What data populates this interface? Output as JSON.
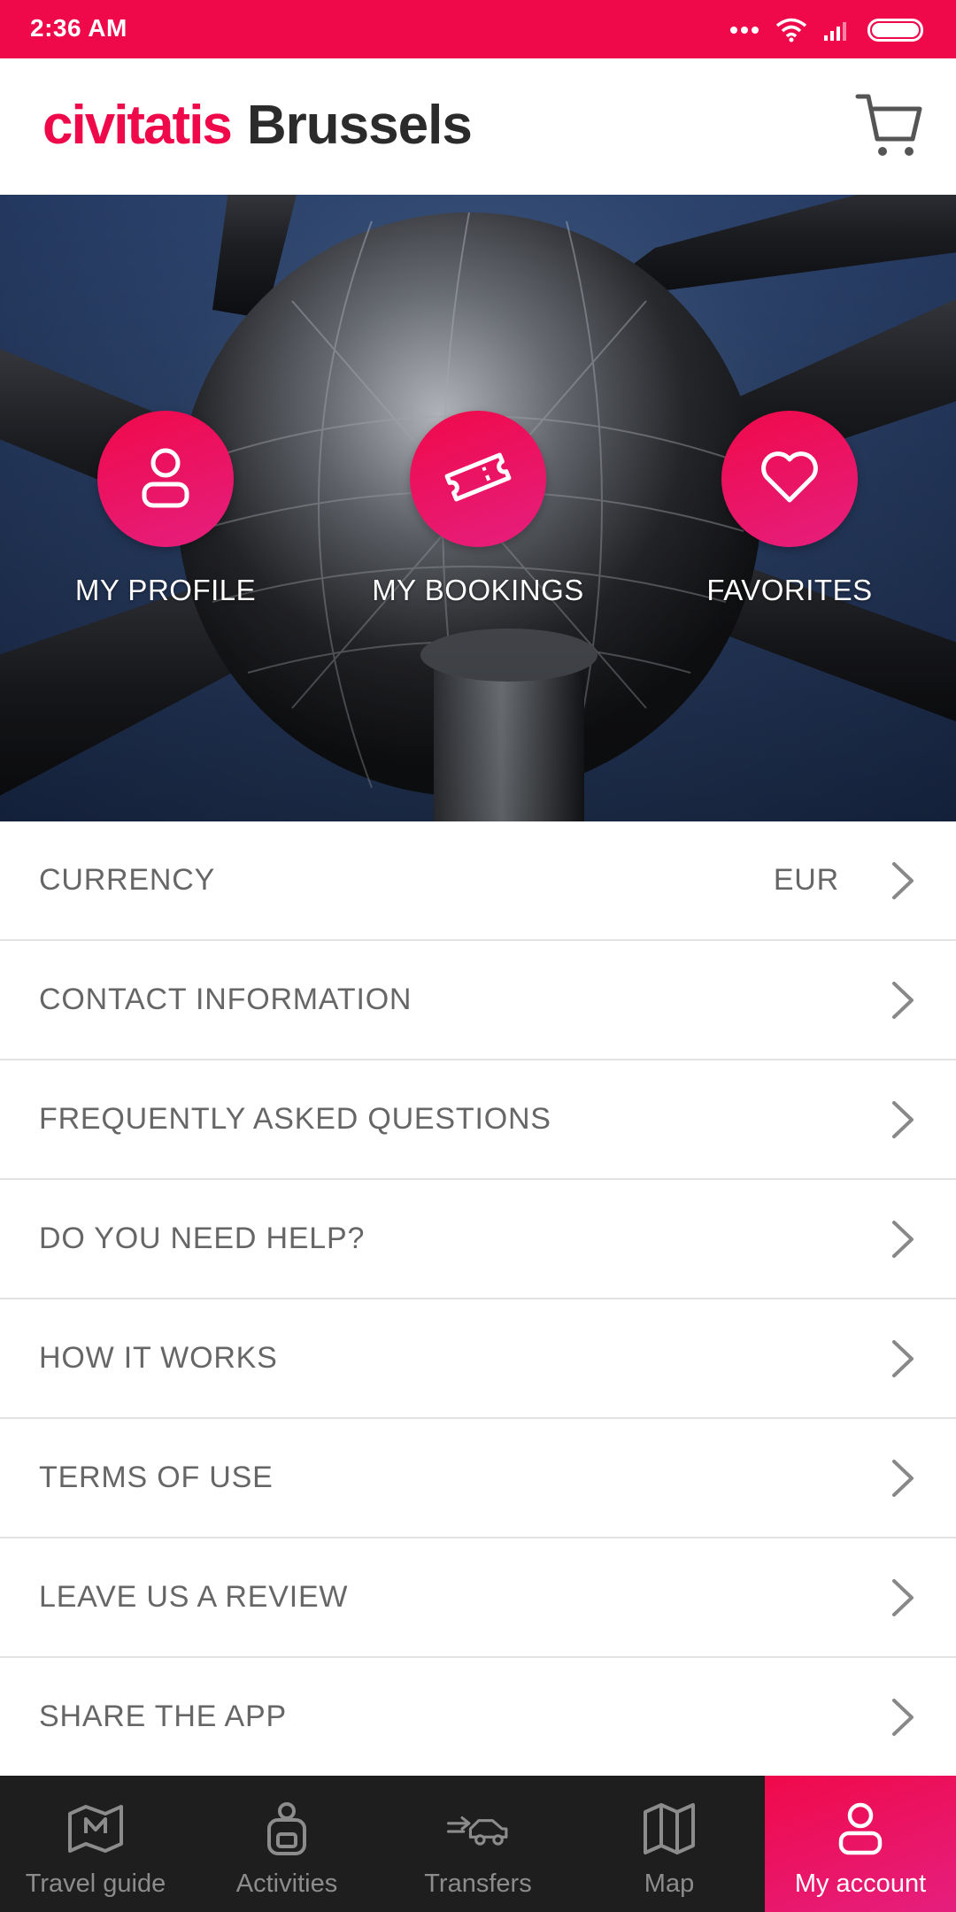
{
  "status_bar": {
    "time": "2:36 AM",
    "background": "#f0094a",
    "icons": [
      "more-dots-icon",
      "wifi-icon",
      "signal-icon",
      "battery-icon"
    ]
  },
  "header": {
    "logo_text": "civitatis",
    "city": "Brussels",
    "cart_icon": "cart-icon"
  },
  "hero": {
    "actions": [
      {
        "label": "MY PROFILE",
        "icon": "user-icon"
      },
      {
        "label": "MY BOOKINGS",
        "icon": "ticket-icon"
      },
      {
        "label": "FAVORITES",
        "icon": "heart-icon"
      }
    ]
  },
  "menu": {
    "items": [
      {
        "label": "CURRENCY",
        "value": "EUR"
      },
      {
        "label": "CONTACT INFORMATION",
        "value": ""
      },
      {
        "label": "FREQUENTLY ASKED QUESTIONS",
        "value": ""
      },
      {
        "label": "DO YOU NEED HELP?",
        "value": ""
      },
      {
        "label": "HOW IT WORKS",
        "value": ""
      },
      {
        "label": "TERMS OF USE",
        "value": ""
      },
      {
        "label": "LEAVE US A REVIEW",
        "value": ""
      },
      {
        "label": "SHARE THE APP",
        "value": ""
      }
    ]
  },
  "bottom_nav": {
    "items": [
      {
        "label": "Travel guide",
        "icon": "map-pin-icon",
        "active": false
      },
      {
        "label": "Activities",
        "icon": "backpack-icon",
        "active": false
      },
      {
        "label": "Transfers",
        "icon": "car-icon",
        "active": false
      },
      {
        "label": "Map",
        "icon": "map-icon",
        "active": false
      },
      {
        "label": "My account",
        "icon": "user-icon",
        "active": true
      }
    ]
  },
  "colors": {
    "brand": "#f0094a",
    "brand_gradient_end": "#e51f7e",
    "nav_background": "#1f1e1f",
    "menu_text": "#666666"
  }
}
